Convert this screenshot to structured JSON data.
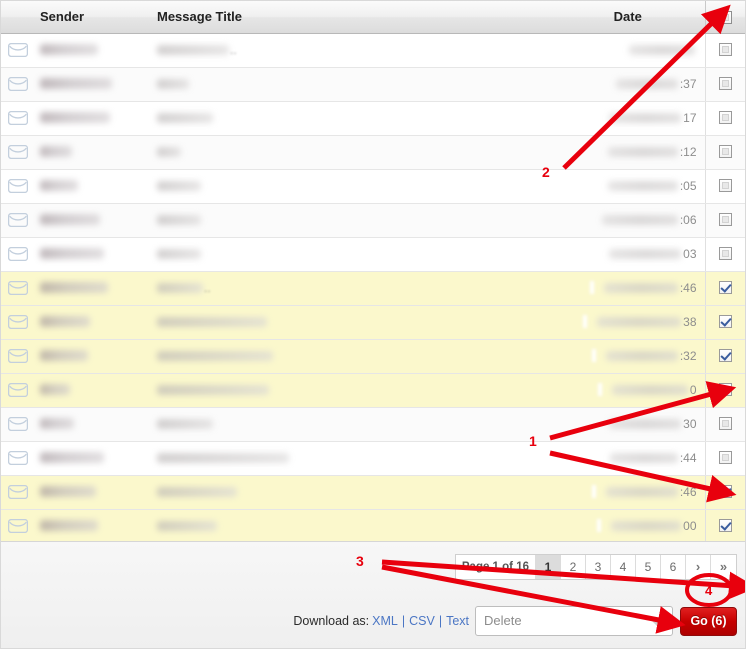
{
  "table": {
    "columns": [
      {
        "key": "icon",
        "label": ""
      },
      {
        "key": "sender",
        "label": "Sender"
      },
      {
        "key": "title",
        "label": "Message Title"
      },
      {
        "key": "date",
        "label": "Date"
      },
      {
        "key": "check",
        "label": ""
      }
    ],
    "header_select_all_checked": false,
    "rows": [
      {
        "icon": "envelope-icon",
        "sender_redacted": true,
        "sender_w": 58,
        "title_redacted": true,
        "title_w": 72,
        "title_tail": "..",
        "date_w": 66,
        "date_tail": "",
        "checked": false,
        "selected": false,
        "attachment": false
      },
      {
        "icon": "envelope-icon",
        "sender_redacted": true,
        "sender_w": 72,
        "title_redacted": true,
        "title_w": 32,
        "title_tail": "",
        "date_w": 62,
        "date_tail": ":37",
        "checked": false,
        "selected": false,
        "attachment": false
      },
      {
        "icon": "envelope-icon",
        "sender_redacted": true,
        "sender_w": 70,
        "title_redacted": true,
        "title_w": 56,
        "title_tail": "",
        "date_w": 72,
        "date_tail": "17",
        "checked": false,
        "selected": false,
        "attachment": false
      },
      {
        "icon": "envelope-icon",
        "sender_redacted": true,
        "sender_w": 32,
        "title_redacted": true,
        "title_w": 24,
        "title_tail": "",
        "date_w": 70,
        "date_tail": ":12",
        "checked": false,
        "selected": false,
        "attachment": false
      },
      {
        "icon": "envelope-icon",
        "sender_redacted": true,
        "sender_w": 38,
        "title_redacted": true,
        "title_w": 44,
        "title_tail": "",
        "date_w": 70,
        "date_tail": ":05",
        "checked": false,
        "selected": false,
        "attachment": false
      },
      {
        "icon": "envelope-icon",
        "sender_redacted": true,
        "sender_w": 60,
        "title_redacted": true,
        "title_w": 44,
        "title_tail": "",
        "date_w": 76,
        "date_tail": ":06",
        "checked": false,
        "selected": false,
        "attachment": false
      },
      {
        "icon": "envelope-icon",
        "sender_redacted": true,
        "sender_w": 64,
        "title_redacted": true,
        "title_w": 44,
        "title_tail": "",
        "date_w": 72,
        "date_tail": "03",
        "checked": false,
        "selected": false,
        "attachment": false
      },
      {
        "icon": "envelope-icon",
        "sender_redacted": true,
        "sender_w": 68,
        "title_redacted": true,
        "title_w": 46,
        "title_tail": "..",
        "date_w": 74,
        "date_tail": ":46",
        "checked": true,
        "selected": true,
        "attachment": true
      },
      {
        "icon": "envelope-icon",
        "sender_redacted": true,
        "sender_w": 50,
        "title_redacted": true,
        "title_w": 110,
        "title_tail": "",
        "date_w": 84,
        "date_tail": "38",
        "checked": true,
        "selected": true,
        "attachment": true
      },
      {
        "icon": "envelope-icon",
        "sender_redacted": true,
        "sender_w": 48,
        "title_redacted": true,
        "title_w": 116,
        "title_tail": "",
        "date_w": 72,
        "date_tail": ":32",
        "checked": true,
        "selected": true,
        "attachment": true
      },
      {
        "icon": "envelope-icon",
        "sender_redacted": true,
        "sender_w": 30,
        "title_redacted": true,
        "title_w": 112,
        "title_tail": "",
        "date_w": 76,
        "date_tail": "0",
        "checked": true,
        "selected": true,
        "attachment": true
      },
      {
        "icon": "envelope-icon",
        "sender_redacted": true,
        "sender_w": 34,
        "title_redacted": true,
        "title_w": 56,
        "title_tail": "",
        "date_w": 72,
        "date_tail": "30",
        "checked": false,
        "selected": false,
        "attachment": false
      },
      {
        "icon": "envelope-icon",
        "sender_redacted": true,
        "sender_w": 64,
        "title_redacted": true,
        "title_w": 132,
        "title_tail": "",
        "date_w": 68,
        "date_tail": ":44",
        "checked": false,
        "selected": false,
        "attachment": false
      },
      {
        "icon": "envelope-icon",
        "sender_redacted": true,
        "sender_w": 56,
        "title_redacted": true,
        "title_w": 80,
        "title_tail": "",
        "date_w": 72,
        "date_tail": ":46",
        "checked": true,
        "selected": true,
        "attachment": true
      },
      {
        "icon": "envelope-icon",
        "sender_redacted": true,
        "sender_w": 58,
        "title_redacted": true,
        "title_w": 60,
        "title_tail": "",
        "date_w": 70,
        "date_tail": "00",
        "checked": true,
        "selected": true,
        "attachment": true
      }
    ]
  },
  "footer": {
    "pagination": {
      "page_label": "Page 1 of 16",
      "pages": [
        "1",
        "2",
        "3",
        "4",
        "5",
        "6"
      ],
      "current_page": "1",
      "next_label": "›",
      "last_label": "»"
    },
    "download": {
      "label": "Download as:",
      "links": [
        "XML",
        "CSV",
        "Text"
      ],
      "separator": "|"
    },
    "action_select": {
      "value": "Delete",
      "options": [
        "Delete"
      ]
    },
    "go_button": {
      "label": "Go (6)"
    }
  },
  "annotations": [
    {
      "id": "1",
      "label": "1"
    },
    {
      "id": "2",
      "label": "2"
    },
    {
      "id": "3",
      "label": "3"
    },
    {
      "id": "4",
      "label": "4"
    }
  ],
  "colors": {
    "annotation_red": "#e8000d",
    "selected_row": "#fbf8cc",
    "go_button_red": "#c60000",
    "link_blue": "#4b76c4"
  }
}
